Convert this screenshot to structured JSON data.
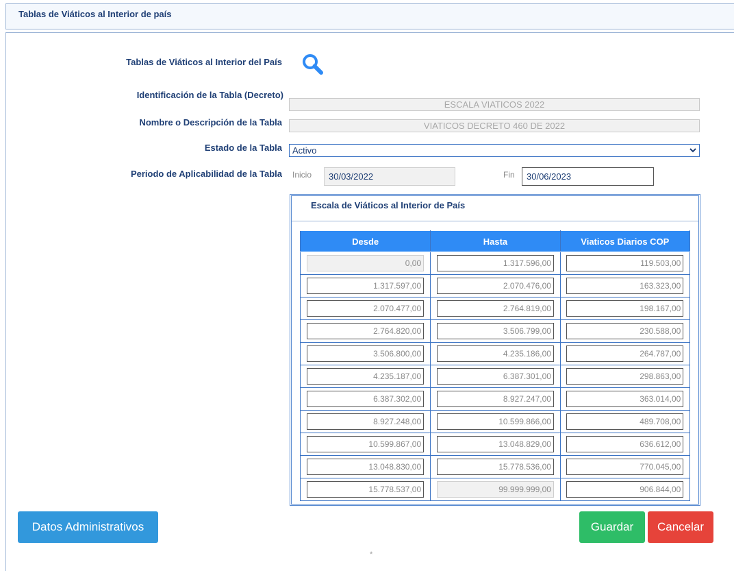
{
  "header": {
    "title": "Tablas de Viáticos al Interior de país"
  },
  "form": {
    "search_label": "Tablas de Viáticos al Interior del País",
    "identificacion_label": "Identificación de la Tabla (Decreto)",
    "identificacion_value": "ESCALA VIATICOS 2022",
    "nombre_label": "Nombre o Descripción de la Tabla",
    "nombre_value": "VIATICOS DECRETO 460 DE 2022",
    "estado_label": "Estado de la Tabla",
    "estado_value": "Activo",
    "periodo_label": "Periodo de Aplicabilidad de la Tabla",
    "inicio_label": "Inicio",
    "inicio_value": "30/03/2022",
    "fin_label": "Fin",
    "fin_value": "30/06/2023"
  },
  "scale": {
    "title": "Escala de Viáticos al Interior de País",
    "headers": [
      "Desde",
      "Hasta",
      "Viaticos Diarios COP"
    ],
    "rows": [
      [
        "0,00",
        "1.317.596,00",
        "119.503,00"
      ],
      [
        "1.317.597,00",
        "2.070.476,00",
        "163.323,00"
      ],
      [
        "2.070.477,00",
        "2.764.819,00",
        "198.167,00"
      ],
      [
        "2.764.820,00",
        "3.506.799,00",
        "230.588,00"
      ],
      [
        "3.506.800,00",
        "4.235.186,00",
        "264.787,00"
      ],
      [
        "4.235.187,00",
        "6.387.301,00",
        "298.863,00"
      ],
      [
        "6.387.302,00",
        "8.927.247,00",
        "363.014,00"
      ],
      [
        "8.927.248,00",
        "10.599.866,00",
        "489.708,00"
      ],
      [
        "10.599.867,00",
        "13.048.829,00",
        "636.612,00"
      ],
      [
        "13.048.830,00",
        "15.778.536,00",
        "770.045,00"
      ],
      [
        "15.778.537,00",
        "99.999.999,00",
        "906.844,00"
      ]
    ]
  },
  "buttons": {
    "admin": "Datos Administrativos",
    "save": "Guardar",
    "cancel": "Cancelar"
  },
  "footer": {
    "asterisk": "*"
  },
  "colors": {
    "accent": "#2f8bf5",
    "label": "#1f3f75",
    "save": "#2ebd67",
    "cancel": "#e6433a",
    "admin": "#3298dc"
  }
}
